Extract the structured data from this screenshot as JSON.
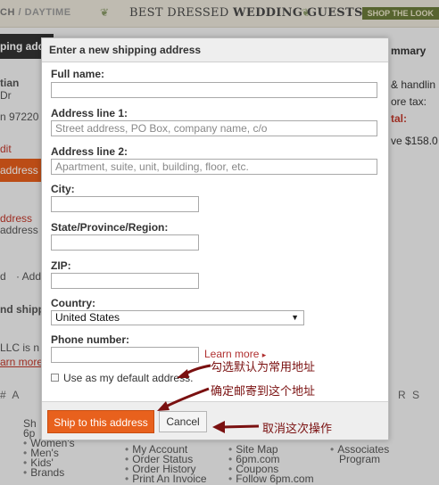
{
  "background": {
    "topbar": {
      "left_text_a": "CH",
      "left_text_b": "/ DAYTIME",
      "center_text_light": "BEST DRESSED",
      "center_text_bold": "WEDDING GUESTS",
      "right_text": "SHOP THE LOOK"
    },
    "left_fragments": {
      "dark_bar": "ping add",
      "name": "tian",
      "line2": "Dr",
      "line3": "n 97220",
      "edit": "dit",
      "orange_bar": "address",
      "link1": "ddress",
      "link2": "address",
      "nav": "d",
      "nav_add": "· Add",
      "shipping": "nd shipp",
      "llc": "LLC is n",
      "learn": "arn more"
    },
    "right_panel": {
      "title": "mmary",
      "line1": "& handlin",
      "line2": "ore tax:",
      "line3": "tal:",
      "line4": "ve $158.0"
    },
    "letters_left": "# A",
    "letters_right": "R S",
    "footer": {
      "col1": [
        "Sh",
        "6p",
        "Women's",
        "Men's",
        "Kids'",
        "Brands"
      ],
      "col2": [
        "My Account",
        "Order Status",
        "Order History",
        "Print An Invoice"
      ],
      "col3": [
        "Site Map",
        "6pm.com",
        "Coupons",
        "Follow 6pm.com"
      ],
      "col4": [
        "Associates",
        "Program"
      ]
    }
  },
  "modal": {
    "title": "Enter a new shipping address",
    "fields": {
      "full_name": {
        "label": "Full name:",
        "value": "",
        "placeholder": ""
      },
      "address1": {
        "label": "Address line 1:",
        "value": "",
        "placeholder": "Street address, PO Box, company name, c/o"
      },
      "address2": {
        "label": "Address line 2:",
        "value": "",
        "placeholder": "Apartment, suite, unit, building, floor, etc."
      },
      "city": {
        "label": "City:",
        "value": "",
        "placeholder": ""
      },
      "state": {
        "label": "State/Province/Region:",
        "value": "",
        "placeholder": ""
      },
      "zip": {
        "label": "ZIP:",
        "value": "",
        "placeholder": ""
      },
      "country": {
        "label": "Country:",
        "selected": "United States"
      },
      "phone": {
        "label": "Phone number:",
        "value": "",
        "placeholder": ""
      }
    },
    "learn_more": "Learn more",
    "default_checkbox": {
      "label": "Use as my default address.",
      "checked": false
    },
    "buttons": {
      "ship": "Ship to this address",
      "cancel": "Cancel"
    }
  },
  "annotations": {
    "default": "勾选默认为常用地址",
    "ship": "确定邮寄到这个地址",
    "cancel": "取消这次操作",
    "color": "#7a1010"
  }
}
